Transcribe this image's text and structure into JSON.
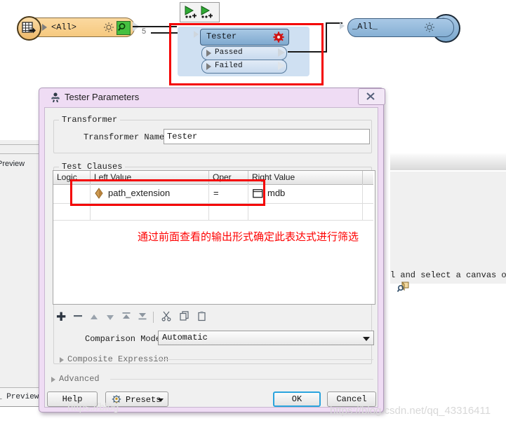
{
  "canvas": {
    "reader_node": {
      "label": "<All>",
      "icon": "table-reader-icon",
      "gear_icon": "gear-icon",
      "inspect_icon": "magnifier-green-icon",
      "port_count": "5"
    },
    "mini_toolbar": {
      "icons": [
        "run-to-this-icon",
        "run-from-this-icon"
      ]
    },
    "tester_node": {
      "title": "Tester",
      "gear_icon": "red-gear-icon",
      "outputs": [
        {
          "label": "Passed"
        },
        {
          "label": "Failed"
        }
      ]
    },
    "writer_node": {
      "label": "_All_",
      "gear_icon": "gear-icon",
      "inspect_icon": "magnifier-icon"
    }
  },
  "background": {
    "left_tab_label": "Preview",
    "left_tab_label_2": "_ Preview",
    "log_text": "l and select a canvas ob",
    "log_icon": "magnifier-object-icon"
  },
  "dialog": {
    "title": "Tester Parameters",
    "title_icon": "tester-icon",
    "close_label": "✕",
    "transformer_group": {
      "title": "Transformer",
      "name_label": "Transformer Name:",
      "name_value": "Tester"
    },
    "test_clauses_group": {
      "title": "Test Clauses",
      "columns": [
        "Logic",
        "Left Value",
        "Oper",
        "Right Value"
      ],
      "rows": [
        {
          "logic": "",
          "left_value": "path_extension",
          "left_icon": "attribute-icon",
          "oper": "=",
          "right_value": "mdb",
          "right_icon": "constant-icon"
        },
        {
          "logic": "",
          "left_value": "",
          "oper": "",
          "right_value": ""
        }
      ],
      "annotation": "通过前面查看的输出形式确定此表达式进行筛选",
      "toolbar_icons": [
        "add-icon",
        "remove-icon",
        "move-up-icon",
        "move-down-icon",
        "move-to-top-icon",
        "move-to-bottom-icon",
        "cut-icon",
        "copy-icon",
        "paste-icon"
      ],
      "toolbar_glyphs": [
        "✚",
        "▬",
        "▲",
        "▼",
        "⤒",
        "⤓",
        "✂",
        "❐",
        "📋"
      ],
      "comparison_mode_label": "Comparison Mode:",
      "comparison_mode_value": "Automatic",
      "composite_expression_label": "Composite Expression"
    },
    "advanced_label": "Advanced",
    "buttons": {
      "help": "Help",
      "presets": "Presets",
      "ok": "OK",
      "cancel": "Cancel"
    }
  },
  "watermark": {
    "text": "https://blog.csdn.net/qq_43316411",
    "text_left": "https://blog"
  },
  "colors": {
    "dialog_frame": "#efdcf4",
    "accent_ok": "#2aa3dd",
    "annotation_red": "#fe0000",
    "reader_node": "#f6c97f",
    "tester_node": "#7fa9cf"
  }
}
